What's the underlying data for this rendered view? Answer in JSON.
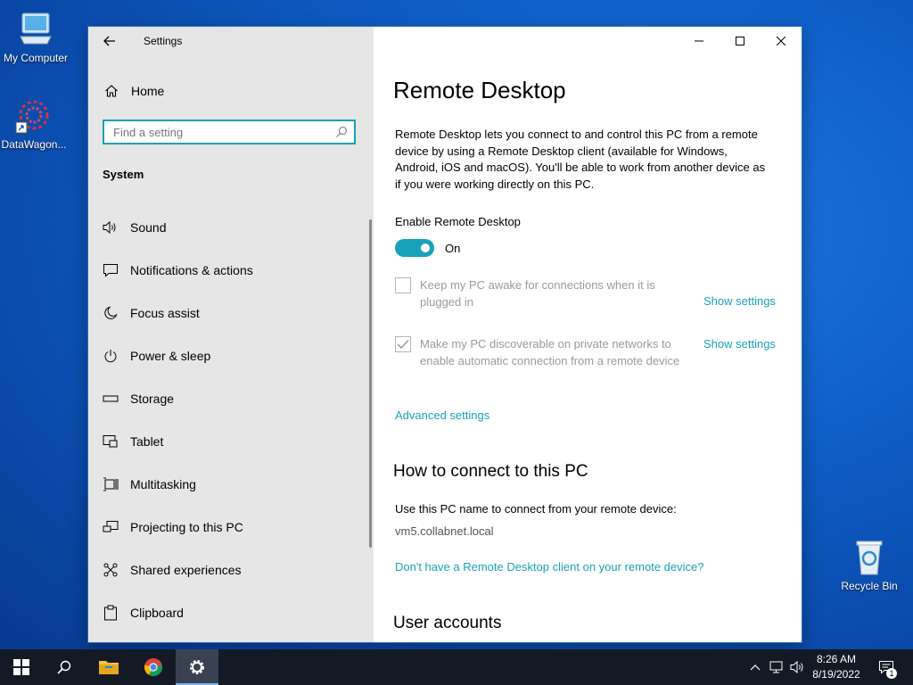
{
  "desktop": {
    "icons": [
      {
        "label": "My Computer"
      },
      {
        "label": "DataWagon..."
      },
      {
        "label": "Recycle Bin"
      }
    ]
  },
  "window": {
    "app_title": "Settings",
    "nav": {
      "home_label": "Home",
      "search_placeholder": "Find a setting",
      "section_header": "System",
      "items": [
        {
          "label": "Sound",
          "icon": "speaker-icon"
        },
        {
          "label": "Notifications & actions",
          "icon": "notification-icon"
        },
        {
          "label": "Focus assist",
          "icon": "moon-icon"
        },
        {
          "label": "Power & sleep",
          "icon": "power-icon"
        },
        {
          "label": "Storage",
          "icon": "storage-icon"
        },
        {
          "label": "Tablet",
          "icon": "tablet-icon"
        },
        {
          "label": "Multitasking",
          "icon": "multitasking-icon"
        },
        {
          "label": "Projecting to this PC",
          "icon": "projecting-icon"
        },
        {
          "label": "Shared experiences",
          "icon": "shared-experiences-icon"
        },
        {
          "label": "Clipboard",
          "icon": "clipboard-icon"
        }
      ]
    },
    "content": {
      "title": "Remote Desktop",
      "description": "Remote Desktop lets you connect to and control this PC from a remote device by using a Remote Desktop client (available for Windows, Android, iOS and macOS). You'll be able to work from another device as if you were working directly on this PC.",
      "enable_label": "Enable Remote Desktop",
      "toggle_state": "On",
      "toggle_on": true,
      "option_awake": {
        "label": "Keep my PC awake for connections when it is plugged in",
        "checked": false,
        "link": "Show settings"
      },
      "option_discoverable": {
        "label": "Make my PC discoverable on private networks to enable automatic connection from a remote device",
        "checked": true,
        "link": "Show settings"
      },
      "advanced_link": "Advanced settings",
      "connect_heading": "How to connect to this PC",
      "connect_instruction": "Use this PC name to connect from your remote device:",
      "pc_name": "vm5.collabnet.local",
      "client_link": "Don't have a Remote Desktop client on your remote device?",
      "user_accounts_heading": "User accounts"
    }
  },
  "taskbar": {
    "time": "8:26 AM",
    "date": "8/19/2022",
    "notification_count": "1"
  },
  "colors": {
    "accent": "#17a2b8",
    "taskbar": "#131a26",
    "nav_background": "#e6e6e6"
  }
}
